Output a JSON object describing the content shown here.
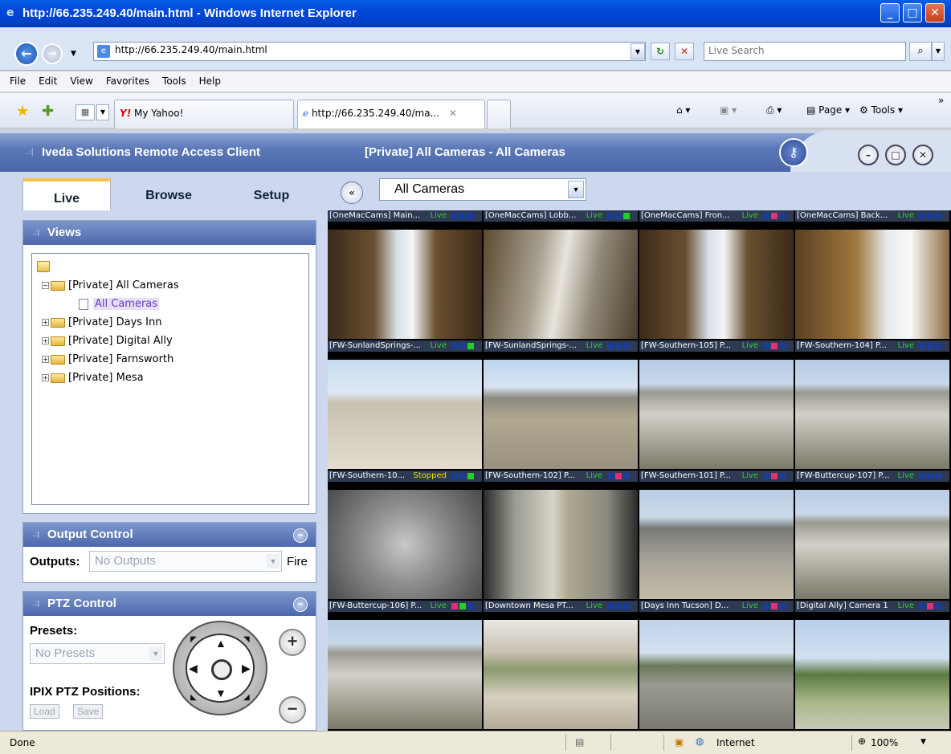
{
  "window": {
    "title": "http://66.235.249.40/main.html - Windows Internet Explorer"
  },
  "address": {
    "url": "http://66.235.249.40/main.html",
    "search_placeholder": "Live Search"
  },
  "menu": [
    "File",
    "Edit",
    "View",
    "Favorites",
    "Tools",
    "Help"
  ],
  "tabs": {
    "yahoo_logo": "Y!",
    "yahoo_label": "My Yahoo!",
    "active_label": "http://66.235.249.40/ma...",
    "page_label": "Page",
    "tools_label": "Tools"
  },
  "app": {
    "title": "Iveda Solutions Remote Access Client",
    "view_title": "[Private] All Cameras - All Cameras"
  },
  "left_tabs": [
    "Live",
    "Browse",
    "Setup"
  ],
  "views": {
    "title": "Views",
    "tree": [
      {
        "label": "[Private] All Cameras",
        "expanded": true
      },
      {
        "label": "All Cameras",
        "selected": true
      },
      {
        "label": "[Private] Days Inn"
      },
      {
        "label": "[Private] Digital Ally"
      },
      {
        "label": "[Private] Farnsworth"
      },
      {
        "label": "[Private] Mesa"
      }
    ]
  },
  "output_control": {
    "title": "Output Control",
    "outputs_label": "Outputs:",
    "outputs_value": "No Outputs",
    "fire_label": "Fire"
  },
  "ptz": {
    "title": "PTZ Control",
    "presets_label": "Presets:",
    "presets_value": "No Presets",
    "ipix_label": "IPIX PTZ Positions:",
    "load_label": "Load",
    "save_label": "Save"
  },
  "camera_select": "All Cameras",
  "cameras": [
    {
      "caption": "[OneMacCams] Main...",
      "status": "Live",
      "sq": [
        "#1a3c9a",
        "#1a3c9a",
        "#1a3c9a"
      ],
      "scene": "indoor-door"
    },
    {
      "caption": "[OneMacCams] Lobb...",
      "status": "Live",
      "sq": [
        "#1a3c9a",
        "#1a3c9a",
        "#22d022"
      ],
      "scene": "hallway"
    },
    {
      "caption": "[OneMacCams] Fron...",
      "status": "Live",
      "sq": [
        "#1a3c9a",
        "#e0307a",
        "#1a3c9a"
      ],
      "scene": "indoor-door"
    },
    {
      "caption": "[OneMacCams] Back...",
      "status": "Live",
      "sq": [
        "#1a3c9a",
        "#1a3c9a",
        "#1a3c9a"
      ],
      "scene": "room"
    },
    {
      "caption": "[FW-SunlandSprings-...",
      "status": "Live",
      "sq": [
        "#1a3c9a",
        "#1a3c9a",
        "#22d022"
      ],
      "scene": "desert"
    },
    {
      "caption": "[FW-SunlandSprings-...",
      "status": "Live",
      "sq": [
        "#1a3c9a",
        "#1a3c9a",
        "#1a3c9a"
      ],
      "scene": "desert-hills"
    },
    {
      "caption": "[FW-Southern-105] P...",
      "status": "Live",
      "sq": [
        "#1a3c9a",
        "#e0307a",
        "#1a3c9a"
      ],
      "scene": "rv-lot"
    },
    {
      "caption": "[FW-Southern-104] P...",
      "status": "Live",
      "sq": [
        "#1a3c9a",
        "#1a3c9a",
        "#1a3c9a"
      ],
      "scene": "rv-lot"
    },
    {
      "caption": "[FW-Southern-10...",
      "status": "Stopped",
      "sq": [
        "#1a3c9a",
        "#1a3c9a",
        "#22d022"
      ],
      "scene": "grey"
    },
    {
      "caption": "[FW-Southern-102] P...",
      "status": "Live",
      "sq": [
        "#1a3c9a",
        "#e0307a",
        "#1a3c9a"
      ],
      "scene": "storage"
    },
    {
      "caption": "[FW-Southern-101] P...",
      "status": "Live",
      "sq": [
        "#1a3c9a",
        "#e0307a",
        "#1a3c9a"
      ],
      "scene": "building"
    },
    {
      "caption": "[FW-Buttercup-107] P...",
      "status": "Live",
      "sq": [
        "#1a3c9a",
        "#1a3c9a",
        "#1a3c9a"
      ],
      "scene": "rv-lot"
    },
    {
      "caption": "[FW-Buttercup-106] P...",
      "status": "Live",
      "sq": [
        "#e0307a",
        "#22d022",
        "#1a3c9a"
      ],
      "scene": "rv-lot"
    },
    {
      "caption": "[Downtown Mesa PT...",
      "status": "Live",
      "sq": [
        "#1a3c9a",
        "#1a3c9a",
        "#1a3c9a"
      ],
      "scene": "street"
    },
    {
      "caption": "[Days Inn Tucson] D...",
      "status": "Live",
      "sq": [
        "#1a3c9a",
        "#e0307a",
        "#1a3c9a"
      ],
      "scene": "highway"
    },
    {
      "caption": "[Digital Ally] Camera 1",
      "status": "Live",
      "sq": [
        "#1a3c9a",
        "#e0307a",
        "#1a3c9a"
      ],
      "scene": "park"
    }
  ],
  "status": {
    "left": "Done",
    "zone": "Internet",
    "zoom": "100%"
  }
}
